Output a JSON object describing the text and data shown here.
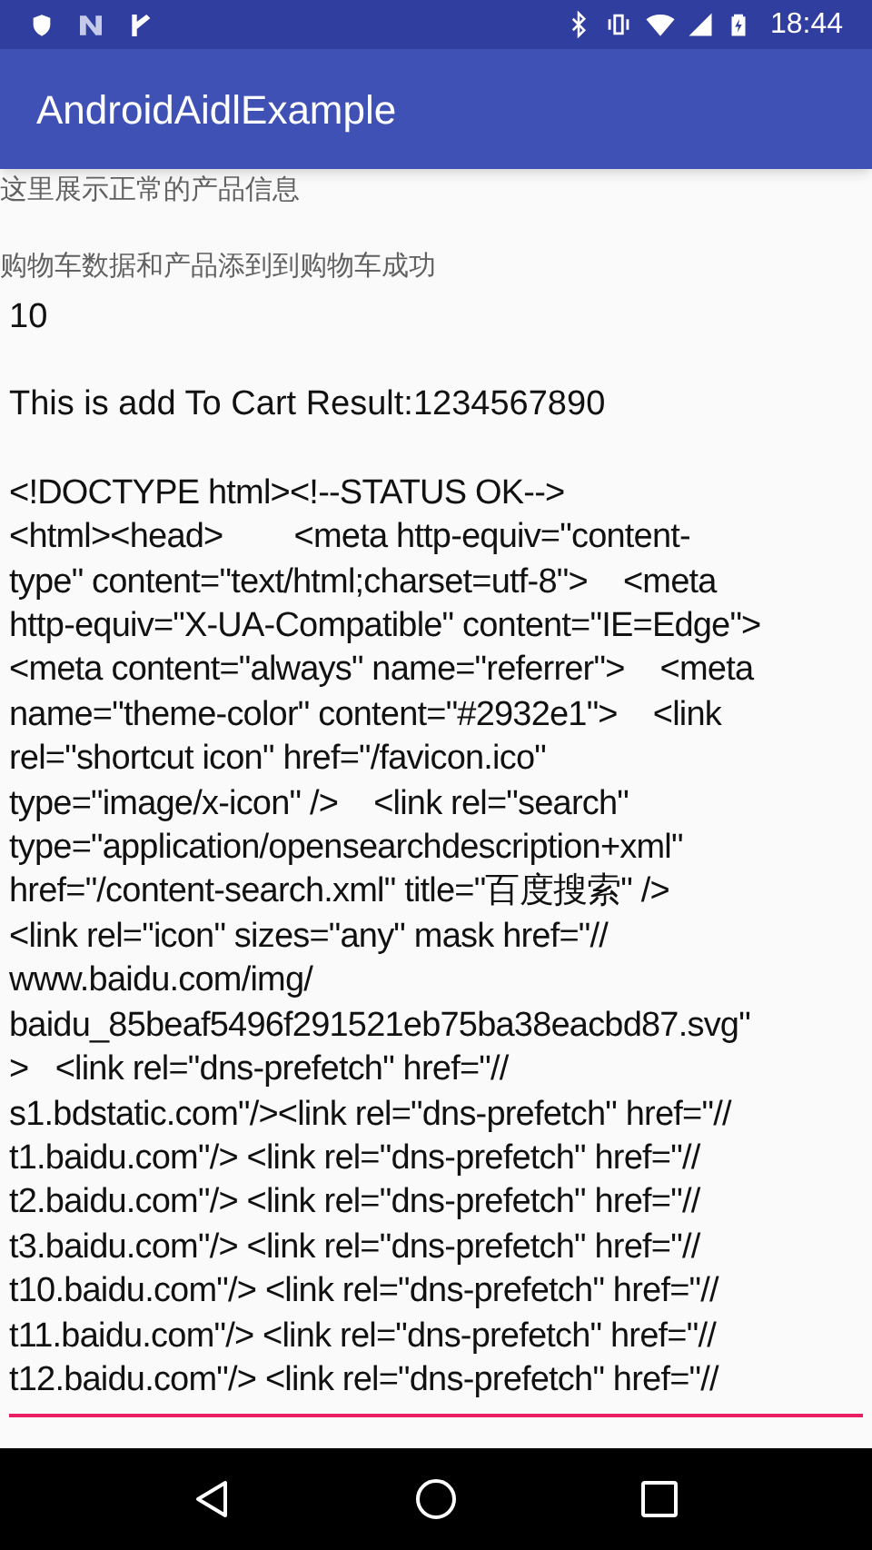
{
  "status_bar": {
    "time": "18:44"
  },
  "app_bar": {
    "title": "AndroidAidlExample"
  },
  "info_texts": [
    "这里展示正常的产品信息",
    "购物车数据和产品添到到购物车成功"
  ],
  "count": "10",
  "result": "This is add To Cart Result:1234567890",
  "response_field": {
    "lines": [
      "<!DOCTYPE html><!--STATUS OK-->",
      "<html><head>        <meta http-equiv=\"content-",
      "type\" content=\"text/html;charset=utf-8\">    <meta",
      "http-equiv=\"X-UA-Compatible\" content=\"IE=Edge\">",
      "<meta content=\"always\" name=\"referrer\">    <meta",
      "name=\"theme-color\" content=\"#2932e1\">    <link",
      "rel=\"shortcut icon\" href=\"/favicon.ico\"",
      "type=\"image/x-icon\" />    <link rel=\"search\"",
      "type=\"application/opensearchdescription+xml\"",
      "href=\"/content-search.xml\" title=\"百度搜索\" />",
      "<link rel=\"icon\" sizes=\"any\" mask href=\"//",
      "www.baidu.com/img/",
      "baidu_85beaf5496f291521eb75ba38eacbd87.svg\"",
      ">   <link rel=\"dns-prefetch\" href=\"//",
      "s1.bdstatic.com\"/><link rel=\"dns-prefetch\" href=\"//",
      "t1.baidu.com\"/> <link rel=\"dns-prefetch\" href=\"//",
      "t2.baidu.com\"/> <link rel=\"dns-prefetch\" href=\"//",
      "t3.baidu.com\"/> <link rel=\"dns-prefetch\" href=\"//",
      "t10.baidu.com\"/> <link rel=\"dns-prefetch\" href=\"//",
      "t11.baidu.com\"/> <link rel=\"dns-prefetch\" href=\"//",
      "t12.baidu.com\"/> <link rel=\"dns-prefetch\" href=\"//"
    ]
  }
}
